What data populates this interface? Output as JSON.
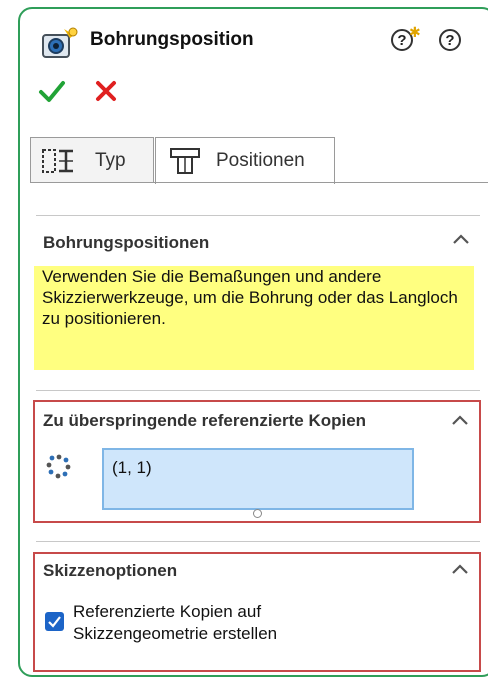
{
  "header": {
    "title": "Bohrungsposition",
    "icon": "hole-wizard-icon",
    "help_pushpin_label": "?",
    "help_label": "?"
  },
  "actions": {
    "ok_icon": "checkmark-icon",
    "cancel_icon": "close-icon"
  },
  "tabs": [
    {
      "label": "Typ",
      "icon": "hole-type-icon",
      "active": false
    },
    {
      "label": "Positionen",
      "icon": "hole-position-icon",
      "active": true
    }
  ],
  "sections": {
    "positions": {
      "title": "Bohrungspositionen",
      "note": "Verwenden Sie die Bemaßungen und andere Skizzierwerkzeuge, um die Bohrung oder das Langloch zu positionieren."
    },
    "skip": {
      "title": "Zu überspringende referenzierte Kopien",
      "items": [
        "(1, 1)"
      ]
    },
    "sketch": {
      "title": "Skizzenoptionen",
      "checkbox_label_1": "Referenzierte Kopien auf",
      "checkbox_label_2": "Skizzengeometrie erstellen",
      "checked": true
    }
  },
  "colors": {
    "panel_border": "#2f9e59",
    "note_bg": "#ffff80",
    "highlight_box": "#c74a4a",
    "list_bg": "#cfe6fb"
  }
}
